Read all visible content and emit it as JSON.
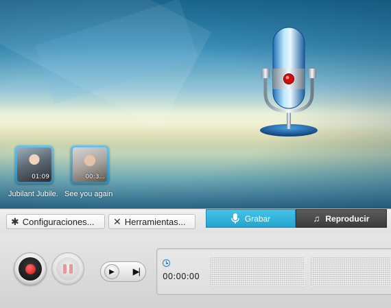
{
  "media": [
    {
      "title": "Jubilant Jubile.",
      "duration": "01:09"
    },
    {
      "title": "See  you again",
      "duration": "00:3..."
    }
  ],
  "toolbar": {
    "settings_label": "Configuraciones...",
    "tools_label": "Herramientas...",
    "record_tab_label": "Grabar",
    "play_tab_label": "Reproducir"
  },
  "recorder": {
    "elapsed_time": "00:00:00"
  },
  "colors": {
    "accent": "#2fb3dd",
    "record_red": "#d40c0c",
    "dark_tab": "#444444"
  },
  "icons": [
    "gear-icon",
    "tools-icon",
    "microphone-icon",
    "music-note-icon",
    "record-icon",
    "pause-icon",
    "play-icon",
    "skip-end-icon",
    "clock-icon"
  ]
}
